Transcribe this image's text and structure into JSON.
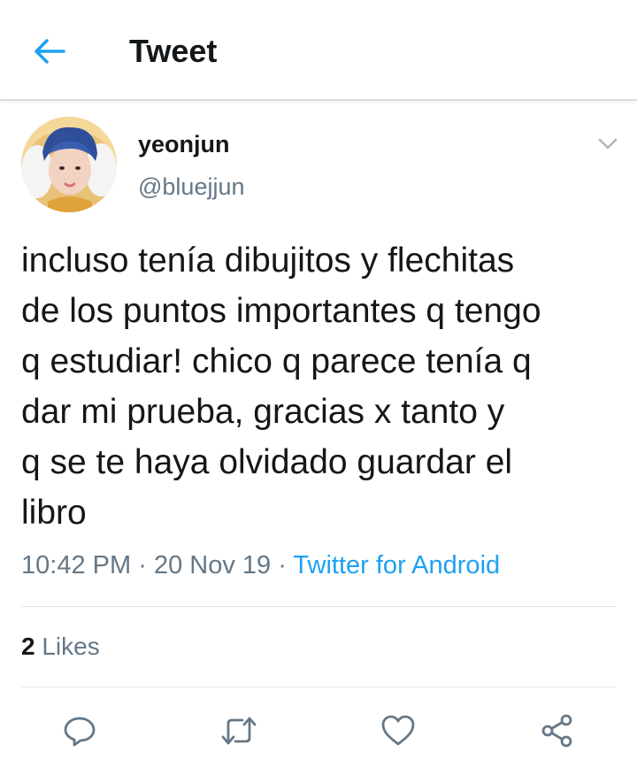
{
  "header": {
    "back_icon": "arrow-left-icon",
    "title": "Tweet"
  },
  "tweet": {
    "display_name": "yeonjun",
    "handle": "@bluejjun",
    "text": "incluso tenía dibujitos y flechitas\nde los puntos importantes q tengo\nq estudiar! chico q parece tenía q\ndar mi prueba, gracias x tanto y\nq se te haya olvidado guardar el\nlibro",
    "time": "10:42 PM",
    "date": "20 Nov 19",
    "separator": "·",
    "source": "Twitter for Android",
    "likes_count": "2",
    "likes_label": "Likes"
  },
  "actions": [
    "reply-icon",
    "retweet-icon",
    "like-icon",
    "share-icon"
  ],
  "colors": {
    "accent": "#1da1f2",
    "secondary_text": "#657786",
    "primary_text": "#14171a",
    "divider": "#e1e8ed"
  }
}
